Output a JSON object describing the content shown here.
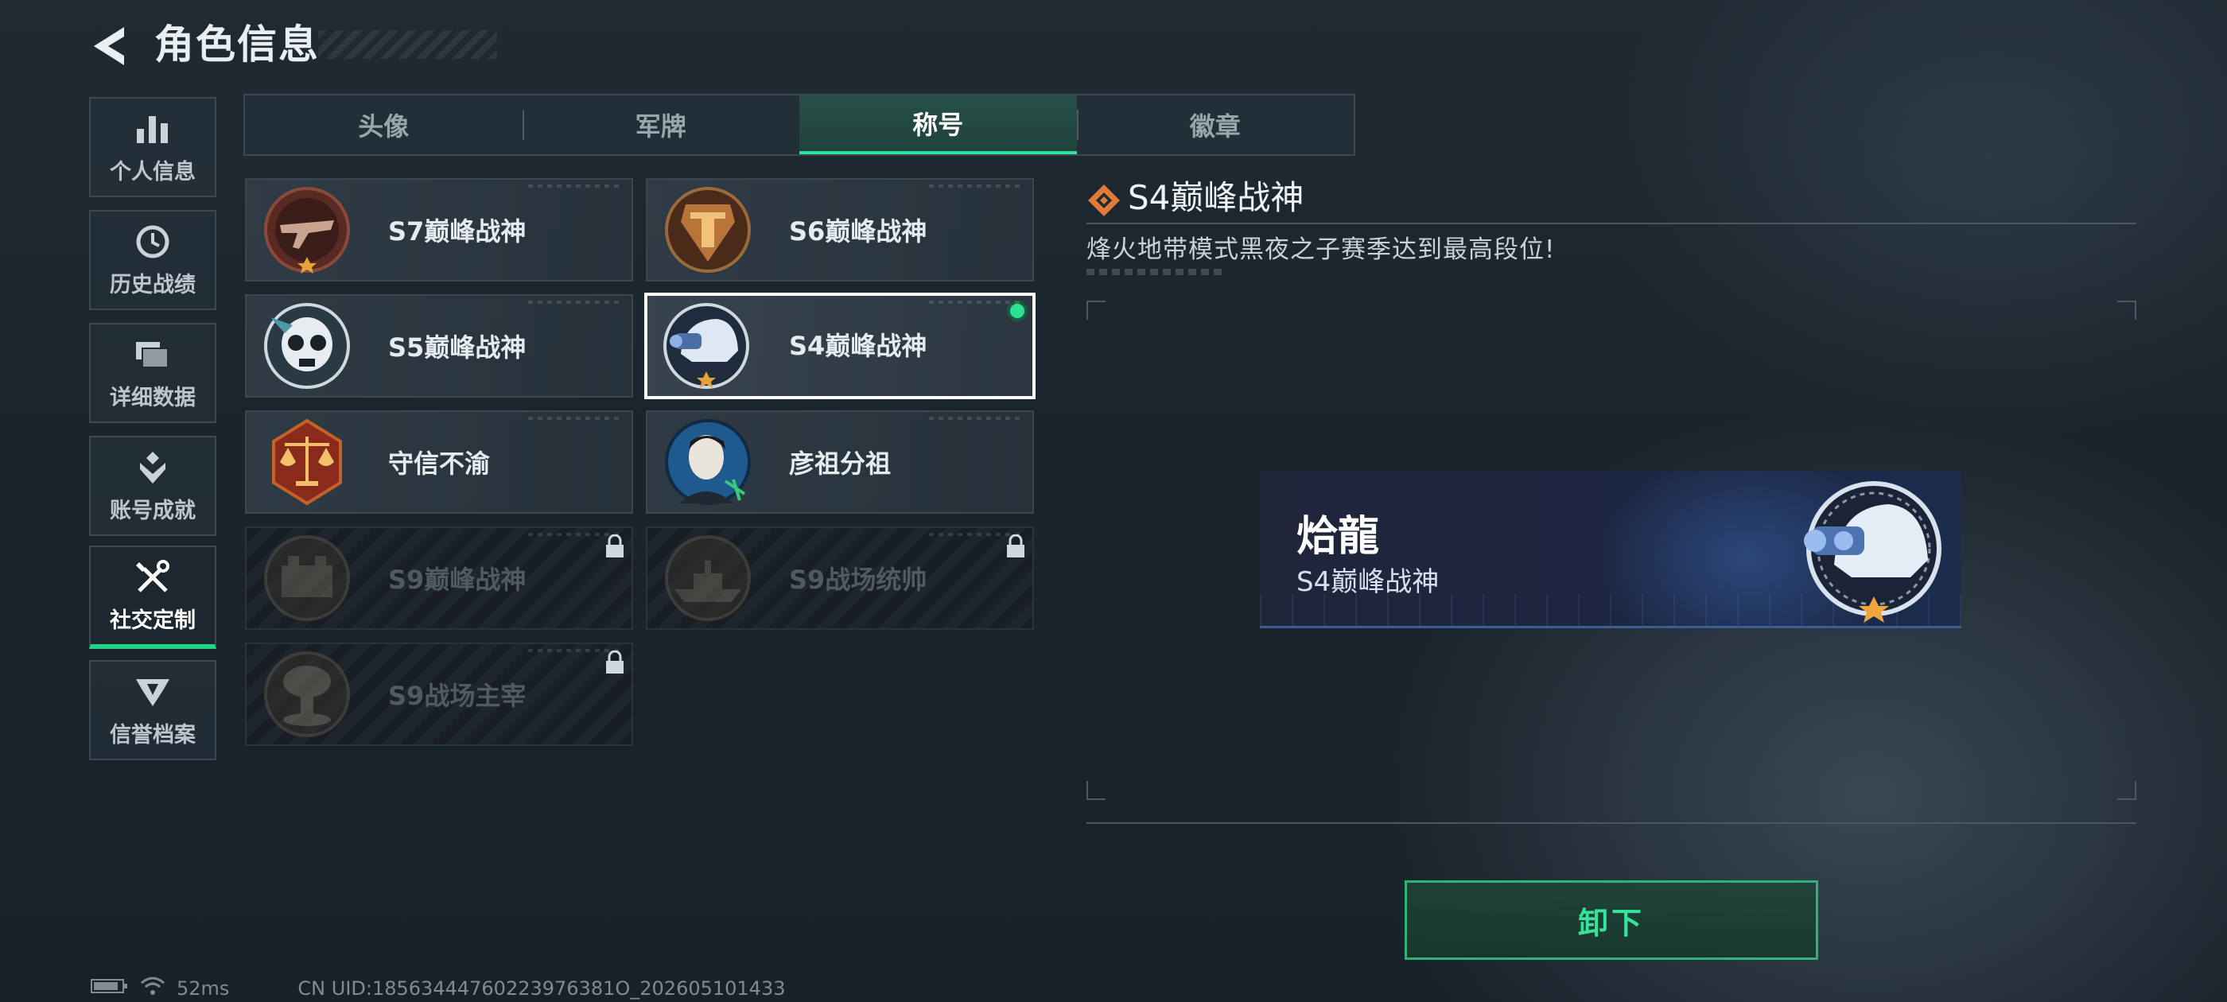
{
  "header": {
    "title": "角色信息"
  },
  "sidebar": {
    "items": [
      {
        "label": "个人信息",
        "icon": "bar-chart-icon"
      },
      {
        "label": "历史战绩",
        "icon": "history-clock-icon"
      },
      {
        "label": "详细数据",
        "icon": "folders-icon"
      },
      {
        "label": "账号成就",
        "icon": "achievement-icon"
      },
      {
        "label": "社交定制",
        "icon": "tools-icon",
        "active": true
      },
      {
        "label": "信誉档案",
        "icon": "shield-wing-icon"
      }
    ]
  },
  "tabs": [
    {
      "label": "头像"
    },
    {
      "label": "军牌"
    },
    {
      "label": "称号",
      "active": true
    },
    {
      "label": "徽章"
    }
  ],
  "titles": [
    {
      "name": "S7巅峰战神",
      "emblem": "crossbow-emblem-icon",
      "locked": false
    },
    {
      "name": "S6巅峰战神",
      "emblem": "pillar-emblem-icon",
      "locked": false
    },
    {
      "name": "S5巅峰战神",
      "emblem": "skull-mask-emblem-icon",
      "locked": false
    },
    {
      "name": "S4巅峰战神",
      "emblem": "night-vision-helmet-emblem-icon",
      "locked": false,
      "selected": true,
      "equipped": true
    },
    {
      "name": "守信不渝",
      "emblem": "scales-emblem-icon",
      "locked": false
    },
    {
      "name": "彦祖分祖",
      "emblem": "portrait-emblem-icon",
      "locked": false
    },
    {
      "name": "S9巅峰战神",
      "emblem": "fortress-emblem-icon",
      "locked": true
    },
    {
      "name": "S9战场统帅",
      "emblem": "warship-emblem-icon",
      "locked": true
    },
    {
      "name": "S9战场主宰",
      "emblem": "mushroom-cloud-emblem-icon",
      "locked": true
    }
  ],
  "detail": {
    "title": "S4巅峰战神",
    "description": "烽火地带模式黑夜之子赛季达到最高段位!",
    "preview": {
      "player_name": "烚龍",
      "title": "S4巅峰战神"
    },
    "unequip_label": "卸下"
  },
  "footer": {
    "ping": "52ms",
    "uid": "CN UID:18563444760223976381O_202605101433"
  },
  "colors": {
    "accent_green": "#2fe29a",
    "card_bg": "#36424c",
    "selected_border": "#ffffff"
  }
}
